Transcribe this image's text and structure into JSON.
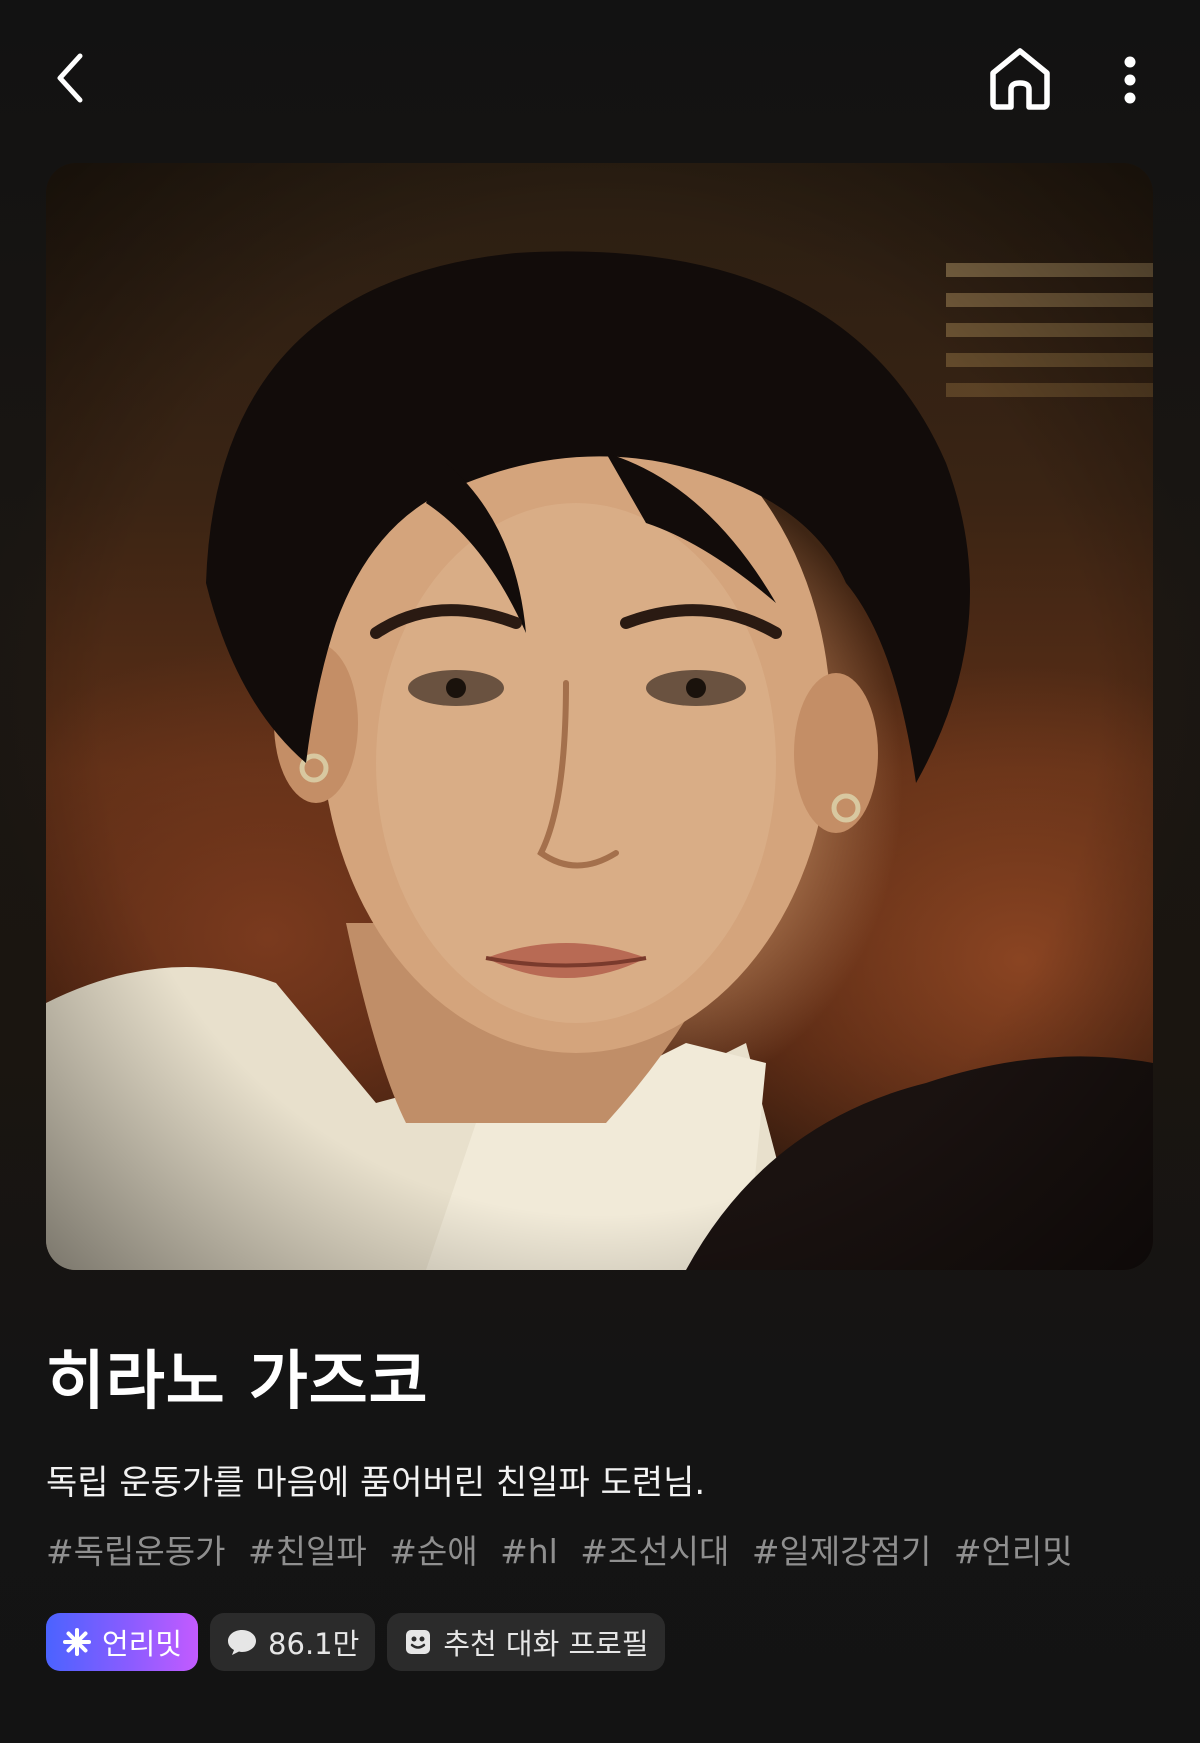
{
  "nav": {
    "back_icon": "chevron-left-icon",
    "home_icon": "home-icon",
    "more_icon": "more-vertical-icon"
  },
  "hero": {
    "image": "character-portrait"
  },
  "character": {
    "name": "히라노 가즈코",
    "description": "독립 운동가를 마음에 품어버린 친일파 도련님.",
    "tags": [
      "#독립운동가",
      "#친일파",
      "#순애",
      "#hl",
      "#조선시대",
      "#일제강점기",
      "#언리밋"
    ]
  },
  "badges": {
    "unlimit_label": "언리밋",
    "unlimit_icon": "sparkle-icon",
    "chat_count": "86.1만",
    "chat_icon": "chat-bubble-icon",
    "profile_label": "추천 대화 프로필",
    "profile_icon": "profile-card-icon"
  },
  "colors": {
    "background": "#131313",
    "badge_gradient_start": "#4b63ff",
    "badge_gradient_end": "#c35bff",
    "tag_text": "#8f8f8f",
    "badge_bg": "#2b2b2b"
  }
}
